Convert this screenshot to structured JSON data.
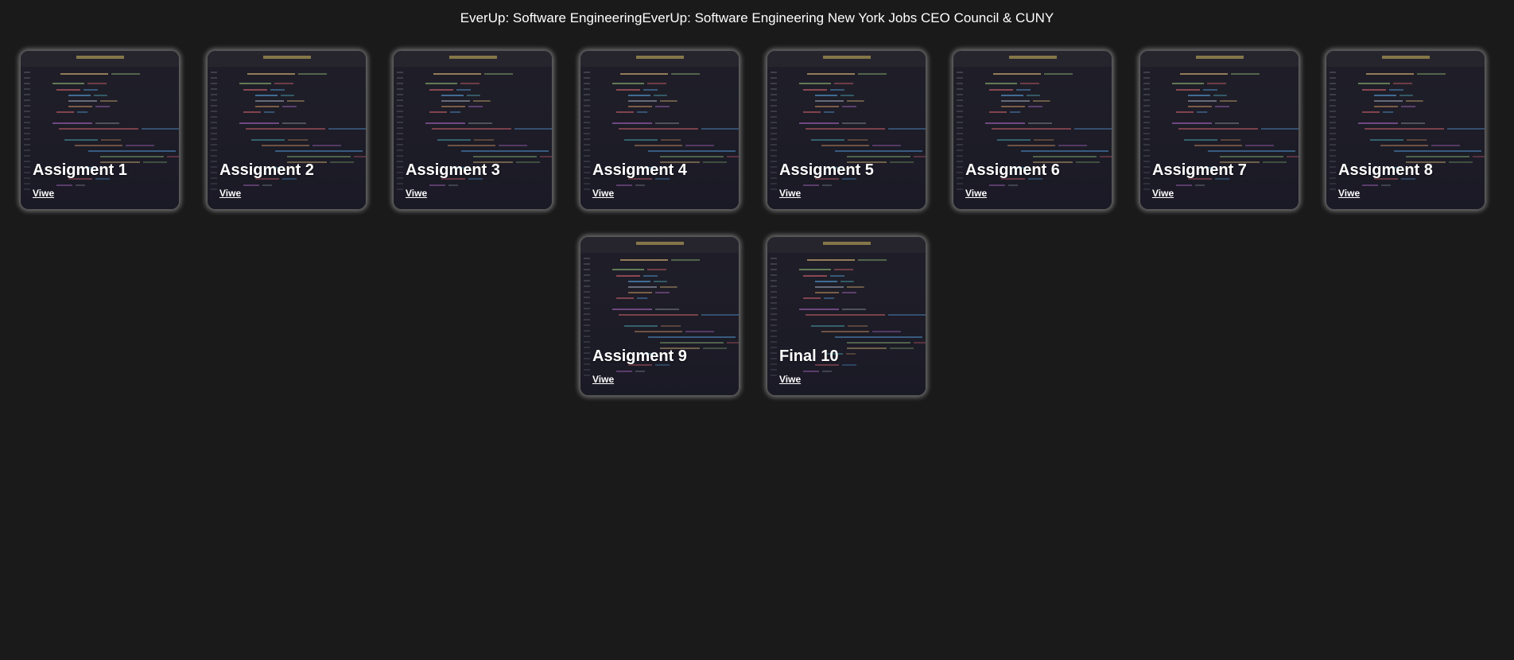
{
  "header": {
    "title": "EverUp: Software EngineeringEverUp: Software Engineering New York Jobs CEO Council & CUNY"
  },
  "cards": [
    {
      "title": "Assigment 1",
      "link_label": "Viwe"
    },
    {
      "title": "Assigment 2",
      "link_label": "Viwe"
    },
    {
      "title": "Assigment 3",
      "link_label": "Viwe"
    },
    {
      "title": "Assigment 4",
      "link_label": "Viwe"
    },
    {
      "title": "Assigment 5",
      "link_label": "Viwe"
    },
    {
      "title": "Assigment 6",
      "link_label": "Viwe"
    },
    {
      "title": "Assigment 7",
      "link_label": "Viwe"
    },
    {
      "title": "Assigment 8",
      "link_label": "Viwe"
    },
    {
      "title": "Assigment 9",
      "link_label": "Viwe"
    },
    {
      "title": "Final 10",
      "link_label": "Viwe"
    }
  ],
  "colors": {
    "background": "#1a1a1a",
    "card_background": "#1c1b22",
    "text": "#ffffff"
  }
}
